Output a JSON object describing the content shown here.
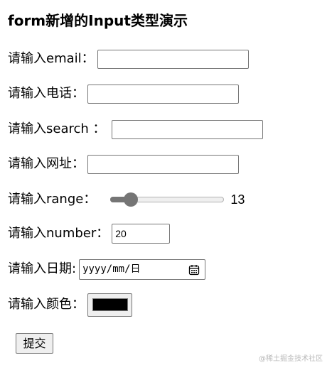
{
  "title": "form新增的Input类型演示",
  "fields": {
    "email": {
      "label": "请输入email：",
      "value": ""
    },
    "phone": {
      "label": "请输入电话：",
      "value": ""
    },
    "search": {
      "label": "请输入search ：",
      "value": ""
    },
    "url": {
      "label": "请输入网址：",
      "value": ""
    },
    "range": {
      "label": "请输入range：",
      "value": "13",
      "fraction": 0.13
    },
    "number": {
      "label": "请输入number：",
      "value": "20"
    },
    "date": {
      "label": "请输入日期:",
      "placeholder": "yyyy/mm/日",
      "icon": "calendar-icon"
    },
    "color": {
      "label": "请输入颜色：",
      "value": "#000000"
    }
  },
  "submit_label": "提交",
  "watermark": "@稀土掘金技术社区",
  "colors": {
    "control_border": "#767676",
    "slider_fill": "#757575",
    "slider_track": "#efefef",
    "swatch": "#000000"
  }
}
